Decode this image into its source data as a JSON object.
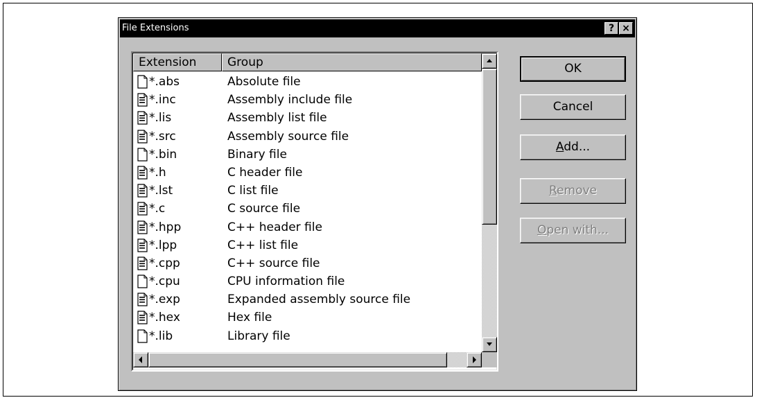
{
  "dialog": {
    "title": "File Extensions",
    "help_glyph": "?",
    "close_glyph": "×"
  },
  "list": {
    "columns": {
      "extension": "Extension",
      "group": "Group"
    },
    "rows": [
      {
        "ext": "*.abs",
        "group": "Absolute file",
        "icon": "blank-file-icon"
      },
      {
        "ext": "*.inc",
        "group": "Assembly include file",
        "icon": "text-file-icon"
      },
      {
        "ext": "*.lis",
        "group": "Assembly list file",
        "icon": "text-file-icon"
      },
      {
        "ext": "*.src",
        "group": "Assembly source file",
        "icon": "text-file-icon"
      },
      {
        "ext": "*.bin",
        "group": "Binary file",
        "icon": "blank-file-icon"
      },
      {
        "ext": "*.h",
        "group": "C header file",
        "icon": "text-file-icon"
      },
      {
        "ext": "*.lst",
        "group": "C list file",
        "icon": "text-file-icon"
      },
      {
        "ext": "*.c",
        "group": "C source file",
        "icon": "text-file-icon"
      },
      {
        "ext": "*.hpp",
        "group": "C++ header file",
        "icon": "text-file-icon"
      },
      {
        "ext": "*.lpp",
        "group": "C++ list file",
        "icon": "text-file-icon"
      },
      {
        "ext": "*.cpp",
        "group": "C++ source file",
        "icon": "text-file-icon"
      },
      {
        "ext": "*.cpu",
        "group": "CPU information file",
        "icon": "blank-file-icon"
      },
      {
        "ext": "*.exp",
        "group": "Expanded assembly source file",
        "icon": "text-file-icon"
      },
      {
        "ext": "*.hex",
        "group": "Hex file",
        "icon": "text-file-icon"
      },
      {
        "ext": "*.lib",
        "group": "Library file",
        "icon": "blank-file-icon"
      }
    ]
  },
  "buttons": {
    "ok": "OK",
    "cancel": "Cancel",
    "add": {
      "mnemonic": "A",
      "rest": "dd..."
    },
    "remove": {
      "mnemonic": "R",
      "rest": "emove"
    },
    "open_with": {
      "mnemonic": "O",
      "rest": "pen with..."
    }
  }
}
